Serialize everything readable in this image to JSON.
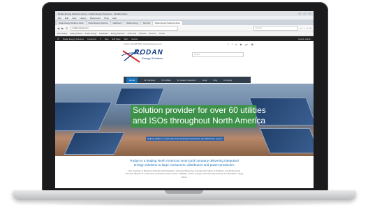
{
  "browser": {
    "window_title": "Rodan Energy Solutions Home – Rodan Energy Solutions – Mozilla Firefox",
    "menu": [
      "File",
      "Edit",
      "View",
      "History",
      "Bookmarks",
      "Tools",
      "Help"
    ],
    "tabs": [
      {
        "label": "Rodan Energy Solutions Home"
      },
      {
        "label": "Rodan Energy Solutions"
      },
      {
        "label": "Dashboard"
      },
      {
        "label": "Rodan Energy"
      },
      {
        "label": "New Tab"
      },
      {
        "label": "Rodan Energy Solutions Home",
        "active": true
      }
    ],
    "url": "rodanenergy.com",
    "search_placeholder": "Search",
    "bookmarks": [
      "Most Visited",
      "Getting Started",
      "Rodan Energy",
      "Dashboard",
      "Energy Solutions",
      "Smart Grid",
      "Products",
      "Services",
      "Contact"
    ]
  },
  "admin_bar": {
    "items": [
      "Rodan Energy Solutions",
      "Customize",
      "0",
      "New",
      "Edit Page",
      "SEO",
      "Events"
    ],
    "user": "Howdy, Admin"
  },
  "site": {
    "topline": "Call Us: 905-625-9900 | info@rodanenergy.com",
    "social_icons": [
      "twitter-icon",
      "facebook-icon",
      "linkedin-icon",
      "youtube-icon",
      "google-plus-icon",
      "rss-icon"
    ],
    "logo_text": "RODAN",
    "logo_sub": "Energy Solutions",
    "search_placeholder": "Search",
    "nav": [
      {
        "label": "Home",
        "active": true
      },
      {
        "label": "for business"
      },
      {
        "label": "for utilities"
      },
      {
        "label": "for power producers"
      },
      {
        "label": "news"
      },
      {
        "label": "blog"
      },
      {
        "label": "company"
      }
    ],
    "hero": {
      "line1": "Solution provider for over 60 utilities",
      "line2": "and ISOs throughout North America",
      "subtext": "Helping utilities to modernize their electricity transmission and distribution system"
    },
    "intro": {
      "headline": "Rodan is a leading North American smart grid company delivering integrated energy solutions to large consumers, distributors and power producers.",
      "body": "Our expertise in Metering & Smart Grid Integration, Demand Response, Energy Information & Analytics, and Engineering Services allows our customers to enhance power system reliability, reduce energy costs and help develop a sustainable energy future."
    }
  },
  "colors": {
    "nav_bg": "#2f3e4a",
    "nav_active": "#1a73b8",
    "hero_box": "#399442",
    "brand_blue": "#0f3a82",
    "logo_red": "#d62b2b",
    "admin_bar": "#222222"
  }
}
